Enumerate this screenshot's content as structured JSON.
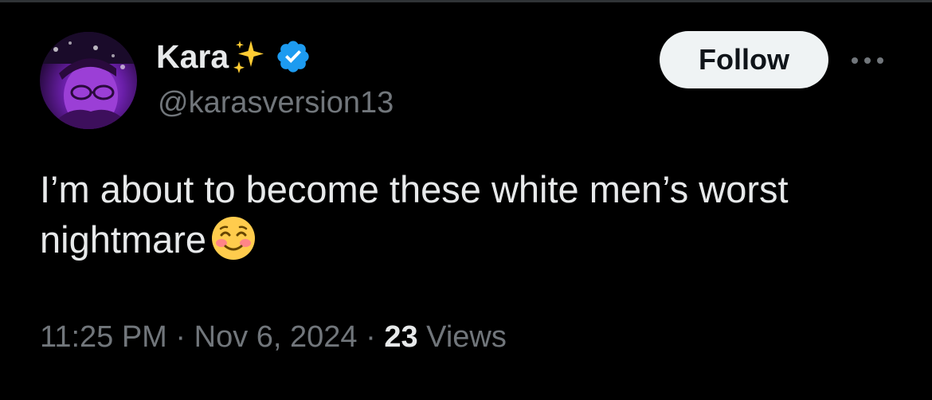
{
  "user": {
    "display_name": "Kara",
    "handle": "@karasversion13",
    "verified": true
  },
  "actions": {
    "follow_label": "Follow",
    "more_icon": "more-horizontal-icon"
  },
  "tweet": {
    "text": "I’m about to become these white men’s worst nightmare",
    "emoji": "smiling-face-with-smiling-eyes-icon"
  },
  "meta": {
    "time": "11:25 PM",
    "separator": "·",
    "date": "Nov 6, 2024",
    "views_count": "23",
    "views_label": "Views"
  },
  "colors": {
    "background": "#000000",
    "primary_text": "#e7e9ea",
    "secondary_text": "#71767b",
    "verified_blue": "#1d9bf0",
    "follow_button_bg": "#eff3f4",
    "sparkle_yellow": "#ffcc33"
  }
}
